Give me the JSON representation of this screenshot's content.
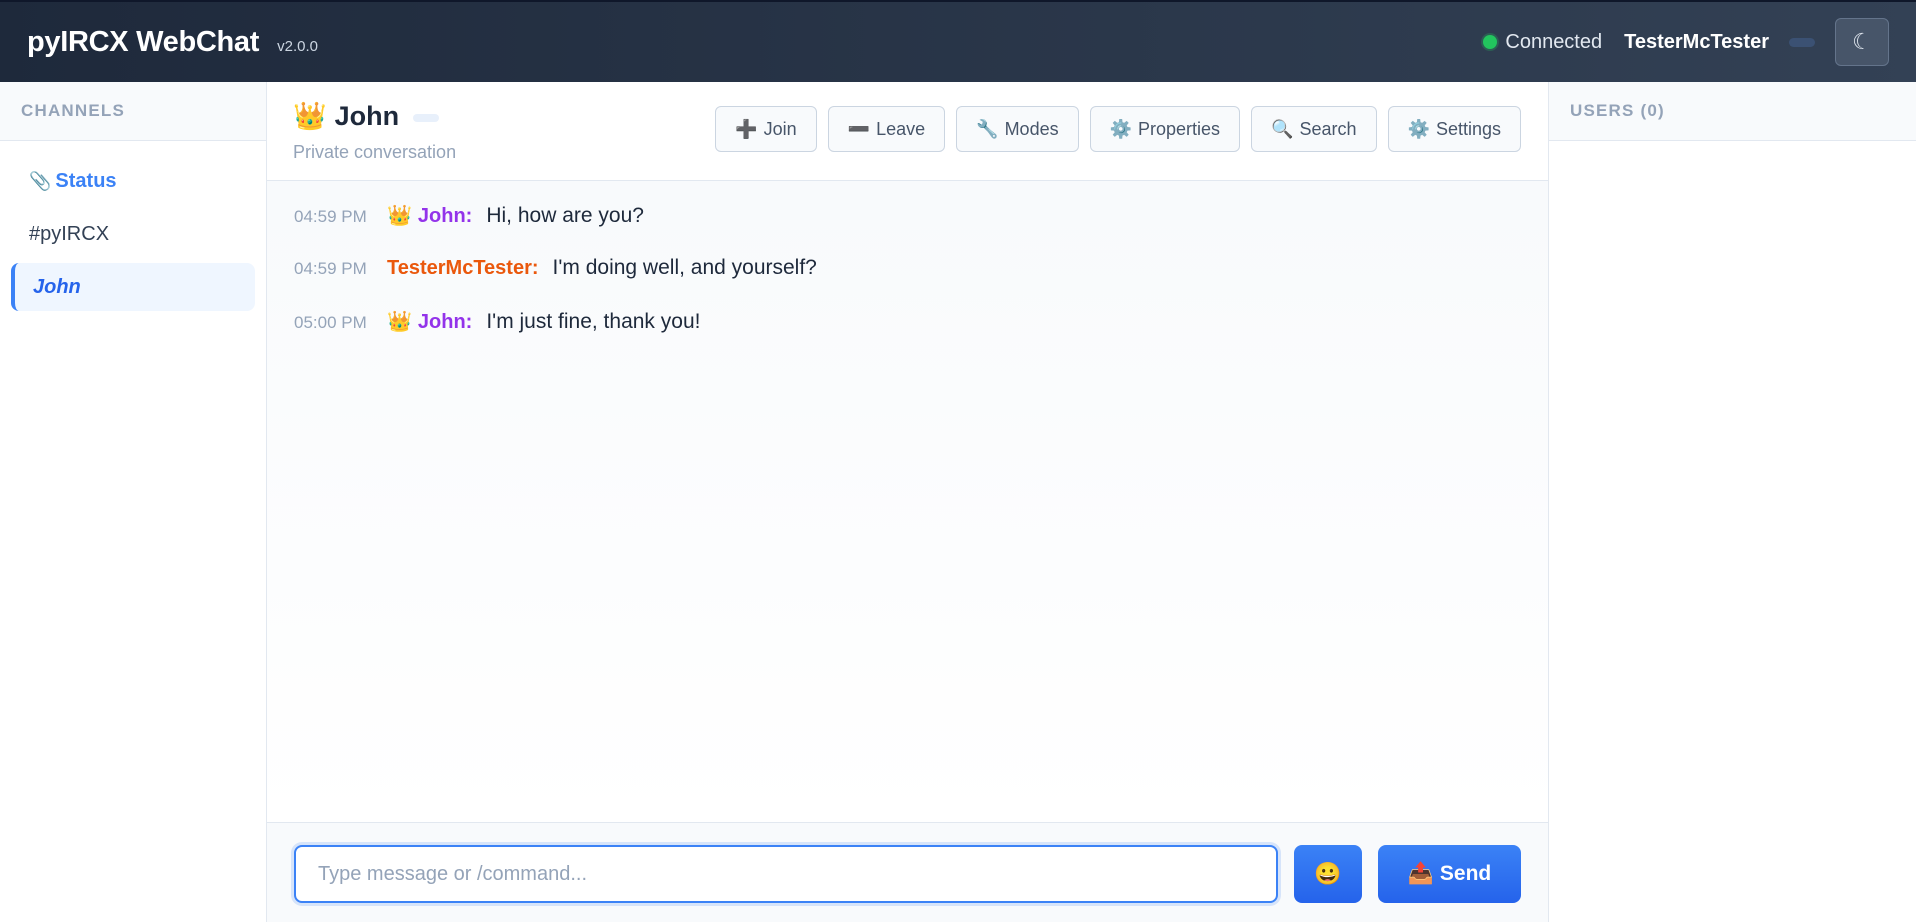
{
  "header": {
    "title": "pyIRCX WebChat",
    "version": "v2.0.0",
    "connection_status": "Connected",
    "nickname": "TesterMcTester",
    "theme_icon": "☾"
  },
  "sidebar": {
    "heading": "CHANNELS",
    "items": [
      {
        "icon": "📎",
        "label": "Status"
      },
      {
        "label": "#pyIRCX"
      },
      {
        "label": "John"
      }
    ]
  },
  "chat": {
    "crown": "👑",
    "title": "John",
    "subtitle": "Private conversation",
    "toolbar": [
      {
        "icon": "➕",
        "label": "Join"
      },
      {
        "icon": "➖",
        "label": "Leave"
      },
      {
        "icon": "🔧",
        "label": "Modes"
      },
      {
        "icon": "⚙️",
        "label": "Properties"
      },
      {
        "icon": "🔍",
        "label": "Search"
      },
      {
        "icon": "⚙️",
        "label": "Settings"
      }
    ],
    "messages": [
      {
        "time": "04:59 PM",
        "crown": "👑",
        "nick": "John:",
        "text": "Hi, how are you?"
      },
      {
        "time": "04:59 PM",
        "nick": "TesterMcTester:",
        "text": "I'm doing well, and yourself?"
      },
      {
        "time": "05:00 PM",
        "crown": "👑",
        "nick": "John:",
        "text": "I'm just fine, thank you!"
      }
    ]
  },
  "composer": {
    "placeholder": "Type message or /command...",
    "emoji_icon": "😀",
    "send_icon": "📤",
    "send_label": "Send"
  },
  "users": {
    "heading": "USERS (0)"
  },
  "colors": {
    "accent": "#3b82f6",
    "connected": "#22c55e",
    "nick_john": "#9333ea",
    "nick_self": "#ea580c"
  }
}
